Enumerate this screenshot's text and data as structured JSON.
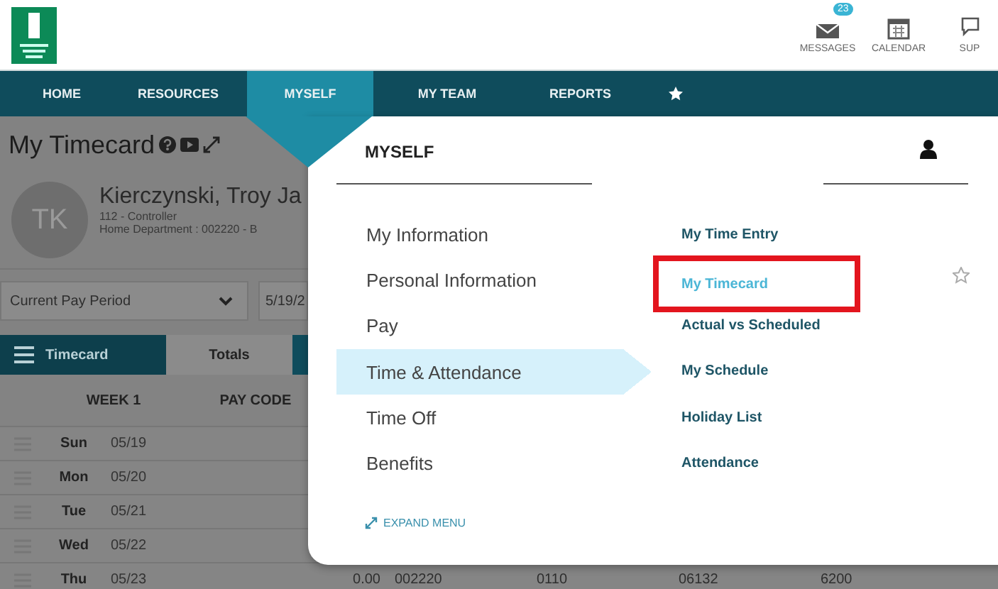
{
  "header": {
    "tools": [
      {
        "kind": "messages",
        "label": "MESSAGES",
        "badge": "23"
      },
      {
        "kind": "calendar",
        "label": "CALENDAR"
      },
      {
        "kind": "support",
        "label": "SUP"
      }
    ]
  },
  "nav": [
    {
      "label": "HOME",
      "selected": false
    },
    {
      "label": "RESOURCES",
      "selected": false
    },
    {
      "label": "MYSELF",
      "selected": true
    },
    {
      "label": "MY TEAM",
      "selected": false
    },
    {
      "label": "REPORTS",
      "selected": false
    }
  ],
  "page": {
    "title": "My Timecard",
    "avatar": "TK",
    "name": "Kierczynski, Troy Ja",
    "job": "112 - Controller",
    "department": "Home Department : 002220 - B",
    "pay_period": "Current Pay Period",
    "date": "5/19/2",
    "tabs": [
      {
        "label": "Timecard",
        "selected": true
      },
      {
        "label": "Totals",
        "selected": false
      }
    ],
    "columns": [
      "WEEK 1",
      "PAY CODE"
    ],
    "rows": [
      {
        "day": "Sun",
        "date": "05/19"
      },
      {
        "day": "Mon",
        "date": "05/20"
      },
      {
        "day": "Tue",
        "date": "05/21"
      },
      {
        "day": "Wed",
        "date": "05/22"
      },
      {
        "day": "Thu",
        "date": "05/23",
        "cells": [
          "0.00",
          "002220",
          "0110",
          "06132",
          "6200"
        ]
      }
    ]
  },
  "menu": {
    "title": "MYSELF",
    "categories": [
      {
        "label": "My Information",
        "selected": false
      },
      {
        "label": "Personal Information",
        "selected": false
      },
      {
        "label": "Pay",
        "selected": false
      },
      {
        "label": "Time & Attendance",
        "selected": true
      },
      {
        "label": "Time Off",
        "selected": false
      },
      {
        "label": "Benefits",
        "selected": false
      }
    ],
    "links": [
      {
        "label": "My Time Entry",
        "selected": false,
        "highlighted": false
      },
      {
        "label": "My Timecard",
        "selected": true,
        "highlighted": true
      },
      {
        "label": "Actual vs Scheduled",
        "selected": false,
        "highlighted": false
      },
      {
        "label": "My Schedule",
        "selected": false,
        "highlighted": false
      },
      {
        "label": "Holiday List",
        "selected": false,
        "highlighted": false
      },
      {
        "label": "Attendance",
        "selected": false,
        "highlighted": false
      }
    ],
    "expand": "EXPAND MENU"
  }
}
